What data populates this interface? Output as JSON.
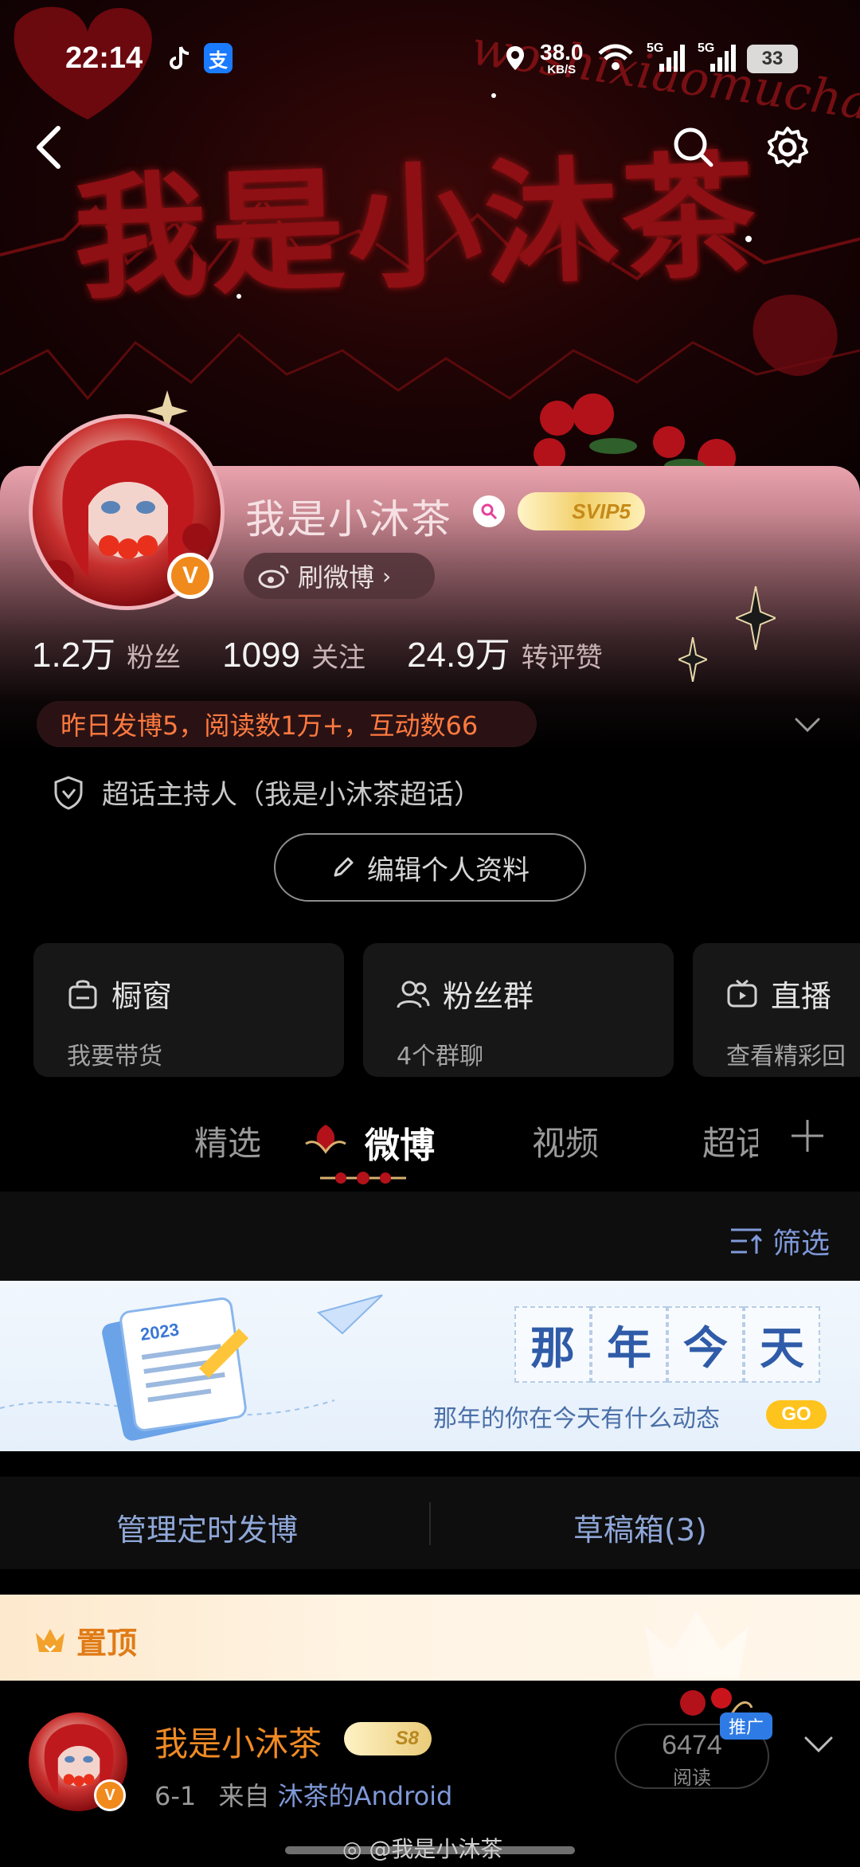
{
  "status_bar": {
    "time": "22:14",
    "net_speed": "38.0",
    "net_speed_unit": "KB/S",
    "signal_1": "5G",
    "signal_2": "5G",
    "battery": "33"
  },
  "banner": {
    "title": "我是小沐茶",
    "script_text": "woshixiaomucha"
  },
  "profile": {
    "name": "我是小沐茶",
    "svip_label": "SVIP5",
    "shua_button": "刷微博",
    "stats": [
      {
        "value": "1.2万",
        "label": "粉丝"
      },
      {
        "value": "1099",
        "label": "关注"
      },
      {
        "value": "24.9万",
        "label": "转评赞"
      }
    ],
    "daily_summary": "昨日发博5，阅读数1万+，互动数66",
    "host_role": "超话主持人（我是小沐茶超话）",
    "edit_button": "编辑个人资料"
  },
  "features": [
    {
      "title": "橱窗",
      "subtitle": "我要带货",
      "icon": "shop-bag-icon"
    },
    {
      "title": "粉丝群",
      "subtitle": "4个群聊",
      "icon": "group-icon"
    },
    {
      "title": "直播",
      "subtitle": "查看精彩回",
      "icon": "tv-icon"
    }
  ],
  "tabs": [
    "精选",
    "微博",
    "视频",
    "超话"
  ],
  "active_tab": "微博",
  "filter": {
    "label": "筛选"
  },
  "memory_banner": {
    "chars": [
      "那",
      "年",
      "今",
      "天"
    ],
    "subtitle": "那年的你在今天有什么动态",
    "go_label": "GO",
    "calendar_year": "2023"
  },
  "manage": {
    "scheduled": "管理定时发博",
    "drafts": "草稿箱(3)"
  },
  "pinned": {
    "label": "置顶"
  },
  "post": {
    "author": "我是小沐茶",
    "level_badge": "S8",
    "date": "6-1",
    "from_prefix": "来自",
    "source": "沐茶的Android",
    "read_count": "6474",
    "read_label": "阅读",
    "ad_tag": "推广"
  },
  "watermark": "@我是小沐茶",
  "colors": {
    "accent_orange": "#f08a24",
    "link_blue": "#7f99d9",
    "banner_red": "#8e0f14",
    "pink_card": "#e9a3ad"
  }
}
